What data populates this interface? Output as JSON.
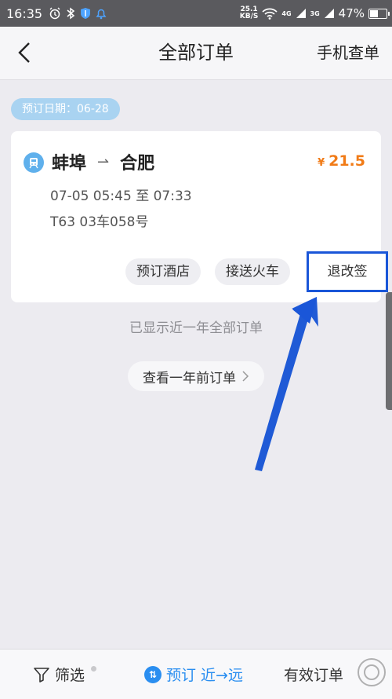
{
  "status_bar": {
    "time": "16:35",
    "speed_value": "25.1",
    "speed_unit": "KB/S",
    "network_1": "4G",
    "network_2": "3G",
    "battery": "47%",
    "icons": [
      "alarm-icon",
      "bluetooth-icon",
      "shield-icon",
      "bell-icon",
      "wifi-icon",
      "signal-icon",
      "battery-icon"
    ]
  },
  "nav": {
    "title": "全部订单",
    "right_link": "手机查单"
  },
  "date_label": "预订日期：06-28",
  "order": {
    "from": "蚌埠",
    "arrow": "⇀",
    "to": "合肥",
    "currency": "¥",
    "price": "21.5",
    "time": "07-05 05:45 至 07:33",
    "seat": "T63 03车058号",
    "actions": {
      "hotel": "预订酒店",
      "pickup": "接送火车",
      "change": "退改签"
    }
  },
  "note": "已显示近一年全部订单",
  "more_button": "查看一年前订单",
  "bottom_bar": {
    "filter": "筛选",
    "sort": "预订 近→远",
    "valid": "有效订单"
  },
  "colors": {
    "accent": "#2a8ef0",
    "price": "#f17b17",
    "highlight": "#1a56d8"
  }
}
